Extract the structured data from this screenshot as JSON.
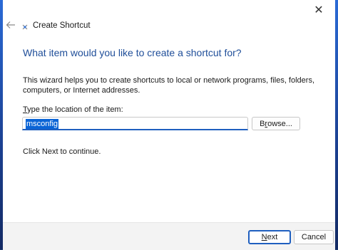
{
  "window": {
    "title": "Create Shortcut",
    "close_glyph": "✕",
    "icons": {
      "back": "arrow-left-icon",
      "app": "shortcut-icon",
      "close": "close-icon"
    }
  },
  "content": {
    "heading": "What item would you like to create a shortcut for?",
    "description": "This wizard helps you to create shortcuts to local or network programs, files, folders, computers, or Internet addresses.",
    "location_label_accel": "T",
    "location_label_rest": "ype the location of the item:",
    "location_value": "msconfig",
    "browse_accel": "r",
    "browse_pre": "B",
    "browse_post": "owse...",
    "continue_text": "Click Next to continue."
  },
  "footer": {
    "next_accel": "N",
    "next_rest": "ext",
    "cancel_label": "Cancel"
  },
  "colors": {
    "heading": "#1f4e99",
    "accent": "#1f5fbf",
    "selection": "#0a64d6",
    "footer_bg": "#f3f3f3",
    "desktop": "#1b3a6e"
  }
}
